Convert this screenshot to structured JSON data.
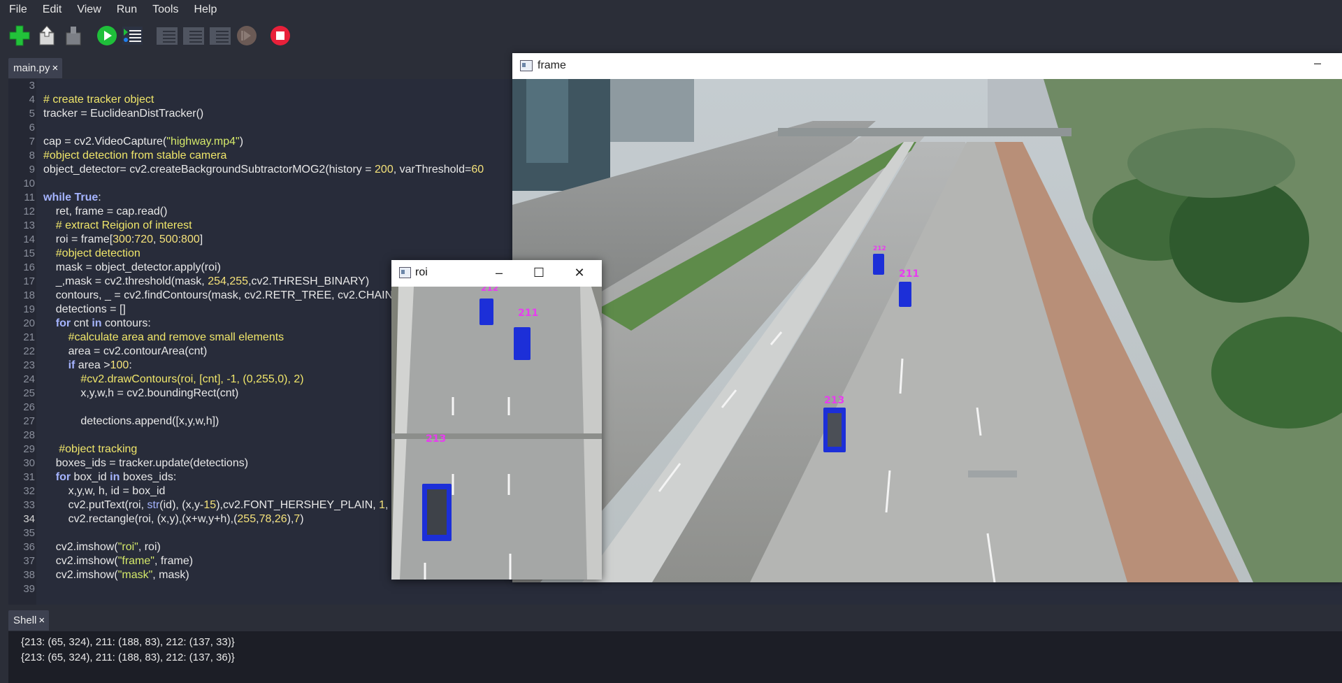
{
  "menu": [
    "File",
    "Edit",
    "View",
    "Run",
    "Tools",
    "Help"
  ],
  "toolbar": {
    "icons": [
      "new-file-icon",
      "load-file-icon",
      "save-file-icon",
      "run-icon",
      "debug-icon",
      "step-over-icon",
      "step-into-icon",
      "step-out-icon",
      "resume-icon",
      "stop-icon"
    ],
    "colors": {
      "new": "#22c23a",
      "run": "#1fbf3a",
      "stop": "#e8203a"
    }
  },
  "editor_tab": {
    "label": "main.py",
    "close": "×"
  },
  "code_lines": [
    {
      "n": "3",
      "html": ""
    },
    {
      "n": "4",
      "html": "<span class=\"cm\"># create tracker object</span>"
    },
    {
      "n": "5",
      "html": "tracker = EuclideanDistTracker()"
    },
    {
      "n": "6",
      "html": ""
    },
    {
      "n": "7",
      "html": "cap = cv2.VideoCapture(<span class=\"st\">\"highway.mp4\"</span>)"
    },
    {
      "n": "8",
      "html": "<span class=\"cm\">#object detection from stable camera</span>"
    },
    {
      "n": "9",
      "html": "object_detector= cv2.createBackgroundSubtractorMOG2(history = <span class=\"num\">200</span>, varThreshold=<span class=\"num\">60</span>"
    },
    {
      "n": "10",
      "html": ""
    },
    {
      "n": "11",
      "html": "<span class=\"kw\">while</span> <span class=\"kw\">True</span>:"
    },
    {
      "n": "12",
      "html": "    ret, frame = cap.read()"
    },
    {
      "n": "13",
      "html": "    <span class=\"cm\"># extract Reigion of interest</span>"
    },
    {
      "n": "14",
      "html": "    roi = frame[<span class=\"num\">300</span>:<span class=\"num\">720</span>, <span class=\"num\">500</span>:<span class=\"num\">800</span>]"
    },
    {
      "n": "15",
      "html": "    <span class=\"cm\">#object detection</span>"
    },
    {
      "n": "16",
      "html": "    mask = object_detector.apply(roi)"
    },
    {
      "n": "17",
      "html": "    _,mask = cv2.threshold(mask, <span class=\"num\">254</span>,<span class=\"num\">255</span>,cv2.THRESH_BINARY)"
    },
    {
      "n": "18",
      "html": "    contours, _ = cv2.findContours(mask, cv2.RETR_TREE, cv2.CHAIN"
    },
    {
      "n": "19",
      "html": "    detections = []"
    },
    {
      "n": "20",
      "html": "    <span class=\"kw\">for</span> cnt <span class=\"kw\">in</span> contours:"
    },
    {
      "n": "21",
      "html": "        <span class=\"cm\">#calculate area and remove small elements</span>"
    },
    {
      "n": "22",
      "html": "        area = cv2.contourArea(cnt)"
    },
    {
      "n": "23",
      "html": "        <span class=\"kw\">if</span> area &gt;<span class=\"num\">100</span>:"
    },
    {
      "n": "24",
      "html": "            <span class=\"cm\">#cv2.drawContours(roi, [cnt], -1, (0,255,0), 2)</span>"
    },
    {
      "n": "25",
      "html": "            x,y,w,h = cv2.boundingRect(cnt)"
    },
    {
      "n": "26",
      "html": ""
    },
    {
      "n": "27",
      "html": "            detections.append([x,y,w,h])"
    },
    {
      "n": "28",
      "html": ""
    },
    {
      "n": "29",
      "html": "     <span class=\"cm\">#object tracking</span>"
    },
    {
      "n": "30",
      "html": "    boxes_ids = tracker.update(detections)"
    },
    {
      "n": "31",
      "html": "    <span class=\"kw\">for</span> box_id <span class=\"kw\">in</span> boxes_ids:"
    },
    {
      "n": "32",
      "html": "        x,y,w, h, id = box_id"
    },
    {
      "n": "33",
      "html": "        cv2.putText(roi, <span class=\"fn\">str</span>(id), (x,y-<span class=\"num\">15</span>),cv2.FONT_HERSHEY_PLAIN, <span class=\"num\">1</span>,"
    },
    {
      "n": "34",
      "html": "        cv2.rectangle(roi, (x,y),(x+w,y+h),(<span class=\"num\">255</span>,<span class=\"num\">78</span>,<span class=\"num\">26</span>),<span class=\"num\">7</span>)"
    },
    {
      "n": "35",
      "html": ""
    },
    {
      "n": "36",
      "html": "    cv2.imshow(<span class=\"st\">\"roi\"</span>, roi)"
    },
    {
      "n": "37",
      "html": "    cv2.imshow(<span class=\"st\">\"frame\"</span>, frame)"
    },
    {
      "n": "38",
      "html": "    cv2.imshow(<span class=\"st\">\"mask\"</span>, mask)"
    },
    {
      "n": "39",
      "html": ""
    }
  ],
  "current_line": "34",
  "shell_tab": {
    "label": "Shell",
    "close": "×"
  },
  "shell_lines": [
    "{213: (65, 324), 211: (188, 83), 212: (137, 33)}",
    "{213: (65, 324), 211: (188, 83), 212: (137, 36)}"
  ],
  "frame_window": {
    "title": "frame",
    "labels": [
      "211",
      "213",
      "212"
    ]
  },
  "roi_window": {
    "title": "roi",
    "labels": [
      "211",
      "213",
      "212"
    ],
    "controls": [
      "minimize-icon",
      "maximize-icon",
      "close-icon"
    ]
  }
}
